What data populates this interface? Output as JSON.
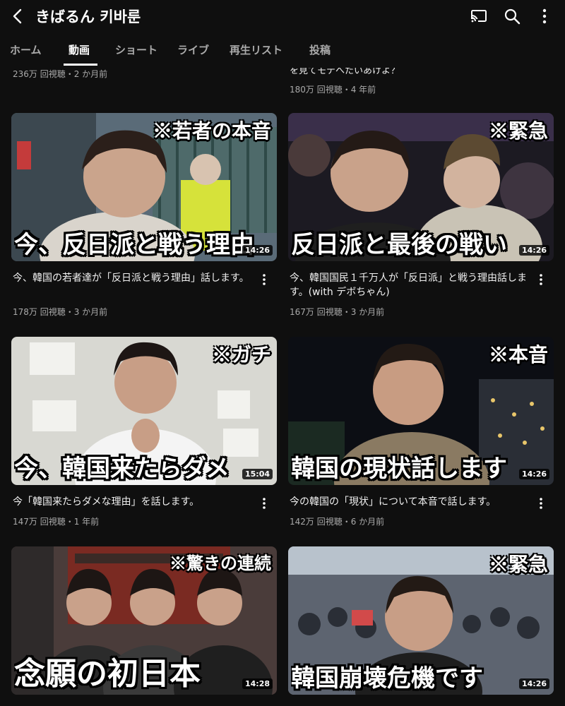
{
  "header": {
    "title": "きばるん 키바룬",
    "icons": [
      "back-arrow-icon",
      "cast-icon",
      "search-icon",
      "more-vert-icon"
    ]
  },
  "tabs": [
    {
      "label": "ホーム",
      "active": false
    },
    {
      "label": "動画",
      "active": true
    },
    {
      "label": "ショート",
      "active": false
    },
    {
      "label": "ライブ",
      "active": false
    },
    {
      "label": "再生リスト",
      "active": false
    },
    {
      "label": "投稿",
      "active": false
    }
  ],
  "partial_row": {
    "left_meta": "236万 回視聴・2 か月前",
    "right_title": "を見てモテへたいあけよ？",
    "right_meta": "180万 回視聴・4 年前"
  },
  "videos": [
    {
      "thumb_tag": "※若者の本音",
      "thumb_caption": "今、反日派と戦う理由",
      "duration": "14:26",
      "title": "今、韓国の若者達が「反日派と戦う理由」話します。",
      "meta": "178万 回視聴・3 か月前"
    },
    {
      "thumb_tag": "※緊急",
      "thumb_caption": "反日派と最後の戦い",
      "duration": "14:26",
      "title": "今、韓国国民１千万人が「反日派」と戦う理由話します。(with デボちゃん)",
      "meta": "167万 回視聴・3 か月前"
    },
    {
      "thumb_tag": "※ガチ",
      "thumb_caption": "今、韓国来たらダメ",
      "duration": "15:04",
      "title": "今「韓国来たらダメな理由」を話します。",
      "meta": "147万 回視聴・1 年前"
    },
    {
      "thumb_tag": "※本音",
      "thumb_caption": "韓国の現状話します",
      "duration": "14:26",
      "title": "今の韓国の「現状」について本音で話します。",
      "meta": "142万 回視聴・6 か月前"
    },
    {
      "thumb_tag": "※驚きの連続",
      "thumb_caption": "念願の初日本",
      "duration": "14:28",
      "title": "",
      "meta": ""
    },
    {
      "thumb_tag": "※緊急",
      "thumb_caption": "韓国崩壊危機です",
      "duration": "14:26",
      "title": "",
      "meta": ""
    }
  ],
  "colors": {
    "background": "#0f0f0f",
    "text_primary": "#f1f1f1",
    "text_secondary": "#aaaaaa"
  }
}
